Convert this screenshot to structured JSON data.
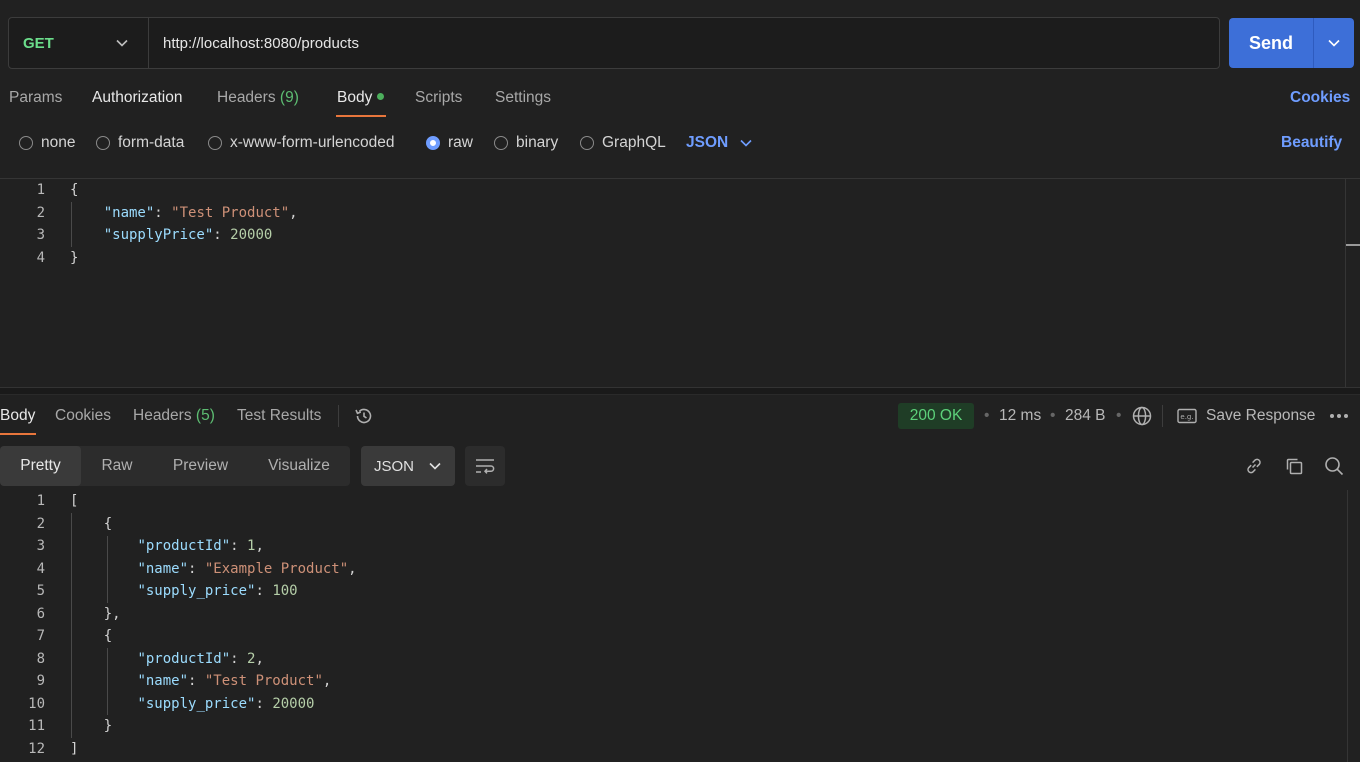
{
  "request": {
    "method": "GET",
    "url": "http://localhost:8080/products",
    "send_label": "Send"
  },
  "request_tabs": {
    "params": "Params",
    "authorization": "Authorization",
    "headers": "Headers",
    "headers_count": "(9)",
    "body": "Body",
    "scripts": "Scripts",
    "settings": "Settings",
    "cookies": "Cookies"
  },
  "body_types": {
    "none": "none",
    "form_data": "form-data",
    "urlencoded": "x-www-form-urlencoded",
    "raw": "raw",
    "binary": "binary",
    "graphql": "GraphQL",
    "selected": "raw",
    "format": "JSON",
    "beautify": "Beautify"
  },
  "request_body": {
    "line_numbers": [
      "1",
      "2",
      "3",
      "4"
    ],
    "open_brace": "{",
    "key1": "\"name\"",
    "val1": "\"Test Product\"",
    "key2": "\"supplyPrice\"",
    "val2": "20000",
    "close_brace": "}"
  },
  "response_tabs": {
    "body": "Body",
    "cookies": "Cookies",
    "headers": "Headers",
    "headers_count": "(5)",
    "test_results": "Test Results"
  },
  "response_meta": {
    "status": "200 OK",
    "time": "12 ms",
    "size": "284 B",
    "save_response": "Save Response"
  },
  "response_toolbar": {
    "pretty": "Pretty",
    "raw": "Raw",
    "preview": "Preview",
    "visualize": "Visualize",
    "format": "JSON"
  },
  "response_body": {
    "line_numbers": [
      "1",
      "2",
      "3",
      "4",
      "5",
      "6",
      "7",
      "8",
      "9",
      "10",
      "11",
      "12"
    ],
    "items": [
      {
        "productId": "1",
        "name": "\"Example Product\"",
        "supply_price": "100"
      },
      {
        "productId": "2",
        "name": "\"Test Product\"",
        "supply_price": "20000"
      }
    ],
    "key_productId": "\"productId\"",
    "key_name": "\"name\"",
    "key_supply_price": "\"supply_price\""
  }
}
